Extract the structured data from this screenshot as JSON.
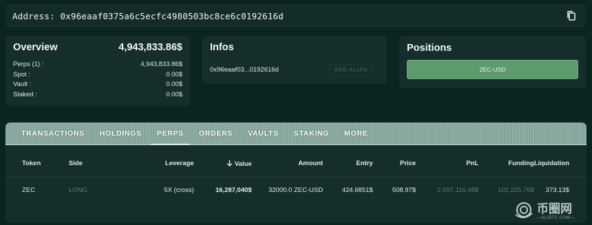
{
  "address": {
    "label": "Address:",
    "value": "0x96eaaf0375a6c5ecfc4980503bc8ce6c0192616d",
    "copy_icon": "copy-icon"
  },
  "overview": {
    "title": "Overview",
    "total": "4,943,833.86$",
    "rows": [
      {
        "label": "Perps (1) :",
        "value": "4,943,833.86$"
      },
      {
        "label": "Spot :",
        "value": "0.00$"
      },
      {
        "label": "Vault :",
        "value": "0.00$"
      },
      {
        "label": "Staked :",
        "value": "0.00$"
      }
    ]
  },
  "infos": {
    "title": "Infos",
    "address_short": "0x96eaaf03...0192616d",
    "alias_button": "ADD ALIAS"
  },
  "positions": {
    "title": "Positions",
    "items": [
      "ZEC-USD"
    ]
  },
  "tabs": [
    {
      "label": "TRANSACTIONS",
      "active": false
    },
    {
      "label": "HOLDINGS",
      "active": false
    },
    {
      "label": "PERPS",
      "active": true
    },
    {
      "label": "ORDERS",
      "active": false
    },
    {
      "label": "VAULTS",
      "active": false
    },
    {
      "label": "STAKING",
      "active": false
    },
    {
      "label": "MORE",
      "active": false
    }
  ],
  "table": {
    "headers": {
      "token": "Token",
      "side": "Side",
      "leverage": "Leverage",
      "value": "Value",
      "amount": "Amount",
      "entry": "Entry",
      "price": "Price",
      "pnl": "PnL",
      "funding": "Funding",
      "liquidation": "Liquidation"
    },
    "sort_icon": "arrow-down-icon",
    "rows": [
      {
        "token": "ZEC",
        "side": "LONG",
        "leverage": "5X (cross)",
        "value": "16,287,040$",
        "amount": "32000.0 ZEC-USD",
        "entry": "424.6851$",
        "price": "508.97$",
        "pnl": "2,697,116.48$",
        "funding": "102,225.76$",
        "liquidation": "373.13$"
      }
    ]
  },
  "watermark": {
    "main": "币圈网",
    "sub": "—ALIBTC.COM—"
  },
  "colors": {
    "background": "#0c2421",
    "card": "#152e2b",
    "accent_green": "#5c9b6d",
    "long_green": "#4f8a5d"
  }
}
